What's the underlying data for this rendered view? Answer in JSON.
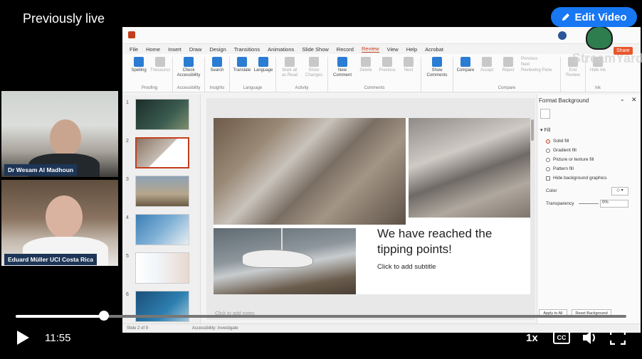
{
  "overlay": {
    "live_tag": "Previously live",
    "edit_video": "Edit Video"
  },
  "ppt": {
    "tabs": [
      "File",
      "Home",
      "Insert",
      "Draw",
      "Design",
      "Transitions",
      "Animations",
      "Slide Show",
      "Record",
      "Review",
      "View",
      "Help",
      "Acrobat"
    ],
    "active_tab": "Review",
    "ribbon_groups": [
      {
        "label": "Proofing",
        "buttons": [
          "Spelling",
          "Thesaurus"
        ]
      },
      {
        "label": "Accessibility",
        "buttons": [
          "Check Accessibility"
        ]
      },
      {
        "label": "Insights",
        "buttons": [
          "Search"
        ]
      },
      {
        "label": "Language",
        "buttons": [
          "Translate",
          "Language"
        ]
      },
      {
        "label": "Activity",
        "buttons": [
          "Mark all as Read",
          "Show Changes"
        ]
      },
      {
        "label": "Comments",
        "buttons": [
          "New Comment",
          "Delete",
          "Previous",
          "Next"
        ]
      },
      {
        "label": "",
        "buttons": [
          "Show Comments"
        ]
      },
      {
        "label": "Compare",
        "buttons": [
          "Compare",
          "Accept",
          "Reject",
          "Previous",
          "Next",
          "Reviewing Pane"
        ]
      },
      {
        "label": "",
        "buttons": [
          "End Review"
        ]
      },
      {
        "label": "Ink",
        "buttons": [
          "Hide Ink"
        ]
      }
    ],
    "slide": {
      "title": "We have reached the tipping points!",
      "subtitle": "Click to add subtitle"
    },
    "notes_placeholder": "Click to add notes",
    "status_left": "Slide 2 of 9",
    "status_access": "Accessibility: Investigate",
    "slide_numbers": [
      "1",
      "2",
      "3",
      "4",
      "5",
      "6"
    ],
    "format_pane": {
      "title": "Format Background",
      "section": "Fill",
      "options": [
        "Solid fill",
        "Gradient fill",
        "Picture or texture fill",
        "Pattern fill"
      ],
      "hide_bg": "Hide background graphics",
      "color_label": "Color",
      "transparency_label": "Transparency",
      "transparency_value": "0%",
      "apply_all": "Apply to All",
      "reset_bg": "Reset Background"
    }
  },
  "streamyard": {
    "logo": "StreamYard",
    "share": "Share"
  },
  "participants": [
    {
      "name": "Dr Wesam Al Madhoun"
    },
    {
      "name": "Eduard Müller UCI Costa Rica"
    }
  ],
  "player": {
    "time": "11:55",
    "speed": "1x",
    "progress_fraction": 0.145,
    "cc": "CC"
  }
}
